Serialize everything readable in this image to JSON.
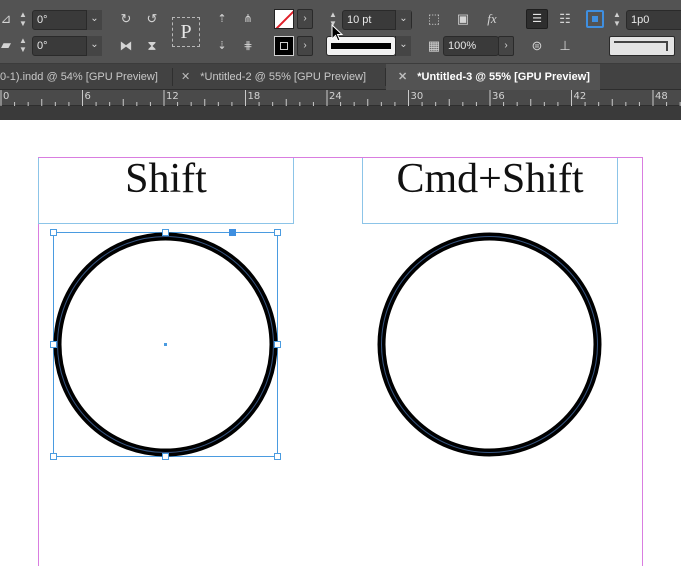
{
  "control_panel": {
    "rotation_value": "0°",
    "shear_value": "0°",
    "stroke_weight": "10 pt",
    "opacity": "100%",
    "size_value": "1p0",
    "stroke_color": "#000000"
  },
  "tabs": [
    {
      "label": "0-1).indd @ 54% [GPU Preview]",
      "active": false,
      "closable": false
    },
    {
      "label": "*Untitled-2 @ 55% [GPU Preview]",
      "active": false,
      "closable": true
    },
    {
      "label": "*Untitled-3 @ 55% [GPU Preview]",
      "active": true,
      "closable": true
    }
  ],
  "ruler": {
    "labels": [
      "0",
      "6",
      "12",
      "18",
      "24",
      "30",
      "36",
      "42",
      "48"
    ]
  },
  "document": {
    "frame_left_text": "Shift",
    "frame_right_text": "Cmd+Shift"
  },
  "colors": {
    "ui_bg": "#535353",
    "guide": "#d97de0",
    "frame_edge": "#8cc4e8",
    "selection": "#4a9be0"
  }
}
